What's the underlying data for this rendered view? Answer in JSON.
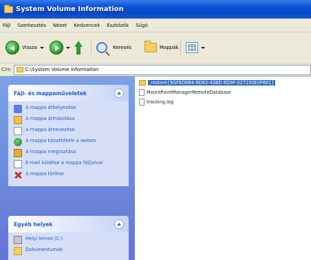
{
  "window": {
    "title": "System Volume Information"
  },
  "menu": {
    "items": [
      "Fájl",
      "Szerkesztés",
      "Nézet",
      "Kedvencek",
      "Eszközök",
      "Súgó"
    ]
  },
  "toolbar": {
    "back_label": "Vissza",
    "search_label": "Keresés",
    "folders_label": "Mappák"
  },
  "address": {
    "label": "Cím",
    "path": "C:\\System Volume Information"
  },
  "sidebar": {
    "file_tasks": {
      "title": "Fájl- és mappaműveletek",
      "items": [
        "A mappa áthelyezése",
        "A mappa átmásolása",
        "A mappa átnevezése",
        "A mappa közzététele a weben",
        "A mappa megosztása",
        "E-mail küldése a mappa fájljaival",
        "A mappa törlése"
      ]
    },
    "other_places": {
      "title": "Egyéb helyek",
      "items": [
        "Helyi lemez (C:)",
        "Dokumentumok"
      ]
    }
  },
  "files": [
    {
      "name": "_restore{9GF6D8B4-8D83-43BD-8D9F-027230E0F681}",
      "type": "folder",
      "selected": true
    },
    {
      "name": "MountPointManagerRemoteDatabase",
      "type": "file",
      "selected": false
    },
    {
      "name": "tracking.log",
      "type": "file",
      "selected": false
    }
  ],
  "colors": {
    "titlebar": "#0a52d6",
    "sidebar_top": "#7ba2e7",
    "sidebar_bottom": "#6375d6",
    "task_link": "#215dc6",
    "selection": "#316ac5",
    "chrome": "#ece9d8"
  }
}
